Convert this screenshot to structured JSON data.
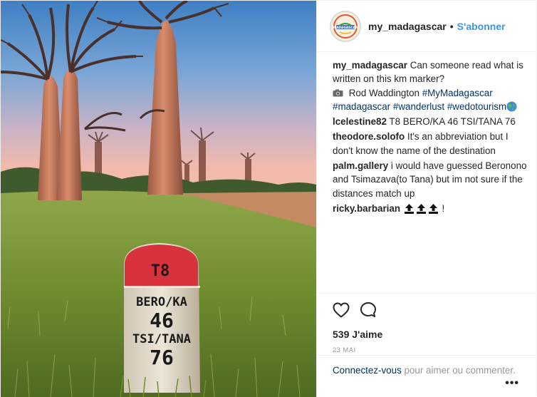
{
  "header": {
    "username": "my_madagascar",
    "separator": "•",
    "follow_label": "S'abonner",
    "avatar_text": "MADAGASCAR"
  },
  "comments": [
    {
      "user": "my_madagascar",
      "parts": [
        {
          "kind": "txt",
          "text": " Can someone read what is written on this km marker?"
        }
      ],
      "caption": true,
      "caption_line2": {
        "name": " Rod Waddington ",
        "tags": [
          "#MyMadagascar",
          "#madagascar",
          "#wanderlust",
          "#wedotourism"
        ]
      }
    },
    {
      "user": "lcelestine82",
      "text": " T8 BERO/KA 46 TSI/TANA 76"
    },
    {
      "user": "theodore.solofo",
      "text": " It's an abbreviation but I don't know the name of the destination"
    },
    {
      "user": "palm.gallery",
      "text": " i would have guessed Beronono and Tsimazava(to Tana) but im not sure if the distances match up"
    },
    {
      "user": "ricky.barbarian",
      "text": " !"
    }
  ],
  "marker": {
    "line1": "T8",
    "line2": "BERO/KA",
    "line3": "46",
    "line4": "TSI/TANA",
    "line5": "76"
  },
  "actions": {
    "like_icon": "heart-icon",
    "comment_icon": "comment-bubble-icon",
    "likes_text": "539 J'aime",
    "date_text": "23 MAI"
  },
  "footer": {
    "login_link": "Connectez-vous",
    "login_rest": " pour aimer ou commenter.",
    "more_label": "•••"
  },
  "colors": {
    "link_blue": "#3897f0",
    "tag_blue": "#003569",
    "sky_top": "#4a86c8",
    "sky_bottom": "#f2b9b0",
    "grass": "#7a9a3a",
    "marker_red": "#d8323c"
  }
}
